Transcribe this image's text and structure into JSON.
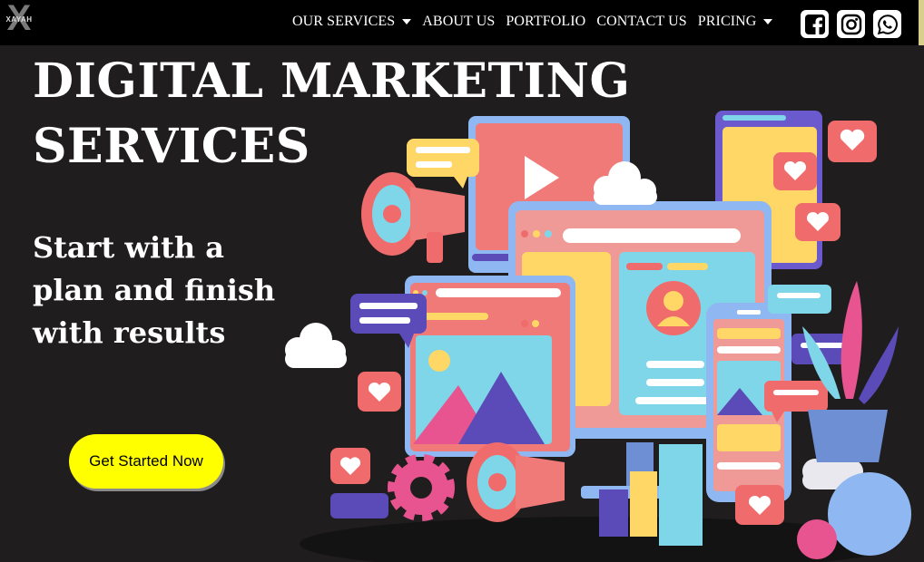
{
  "brand": {
    "logo_letter": "X",
    "logo_text": "XAYAH"
  },
  "nav": {
    "items": [
      {
        "label": "OUR SERVICES",
        "dropdown": true
      },
      {
        "label": "ABOUT US",
        "dropdown": false
      },
      {
        "label": "PORTFOLIO",
        "dropdown": false
      },
      {
        "label": "CONTACT US",
        "dropdown": false
      },
      {
        "label": "PRICING",
        "dropdown": true
      }
    ],
    "socials": [
      "facebook-icon",
      "instagram-icon",
      "whatsapp-icon"
    ]
  },
  "hero": {
    "title": "DIGITAL MARKETING\nSERVICES",
    "subtitle": "Start with a plan and finish with results",
    "cta_label": "Get Started Now"
  },
  "colors": {
    "background": "#1f1d1d",
    "navbar": "#000000",
    "cta": "#ffff00",
    "coral": "#f06b6b",
    "sky": "#7fd6e8",
    "yellow": "#ffd766",
    "purple": "#5b4bb8",
    "pink": "#e8548f",
    "blue": "#8fb8f2"
  }
}
